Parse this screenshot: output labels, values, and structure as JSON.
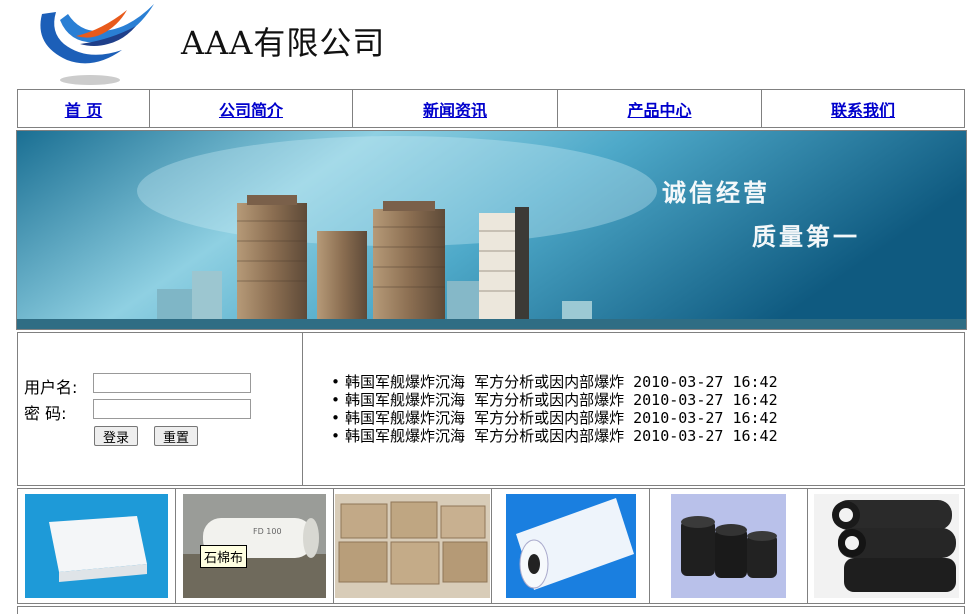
{
  "header": {
    "company_name": "AAA有限公司",
    "logo_icon": "swoosh-logo-icon"
  },
  "nav": {
    "items": [
      {
        "label": "首 页"
      },
      {
        "label": "公司简介"
      },
      {
        "label": "新闻资讯"
      },
      {
        "label": "产品中心"
      },
      {
        "label": "联系我们"
      }
    ]
  },
  "banner": {
    "slogan_line1": "诚信经营",
    "slogan_line2": "质量第一"
  },
  "login": {
    "username_label": "用户名:",
    "password_label": "密 码:",
    "username_value": "",
    "password_value": "",
    "login_button": "登录",
    "reset_button": "重置"
  },
  "news": {
    "items": [
      {
        "title": "韩国军舰爆炸沉海 军方分析或因内部爆炸",
        "time": "2010-03-27 16:42"
      },
      {
        "title": "韩国军舰爆炸沉海 军方分析或因内部爆炸",
        "time": "2010-03-27 16:42"
      },
      {
        "title": "韩国军舰爆炸沉海 军方分析或因内部爆炸",
        "time": "2010-03-27 16:42"
      },
      {
        "title": "韩国军舰爆炸沉海 军方分析或因内部爆炸",
        "time": "2010-03-27 16:42"
      }
    ]
  },
  "products": {
    "tooltip": "石棉布",
    "items": [
      {
        "icon": "white-board-product-icon"
      },
      {
        "icon": "asbestos-cloth-roll-icon"
      },
      {
        "icon": "packed-boxes-icon"
      },
      {
        "icon": "mesh-roll-icon"
      },
      {
        "icon": "black-tape-rolls-icon"
      },
      {
        "icon": "black-foam-tubes-icon"
      }
    ]
  },
  "colors": {
    "nav_link": "#0000cc",
    "border": "#808080"
  }
}
